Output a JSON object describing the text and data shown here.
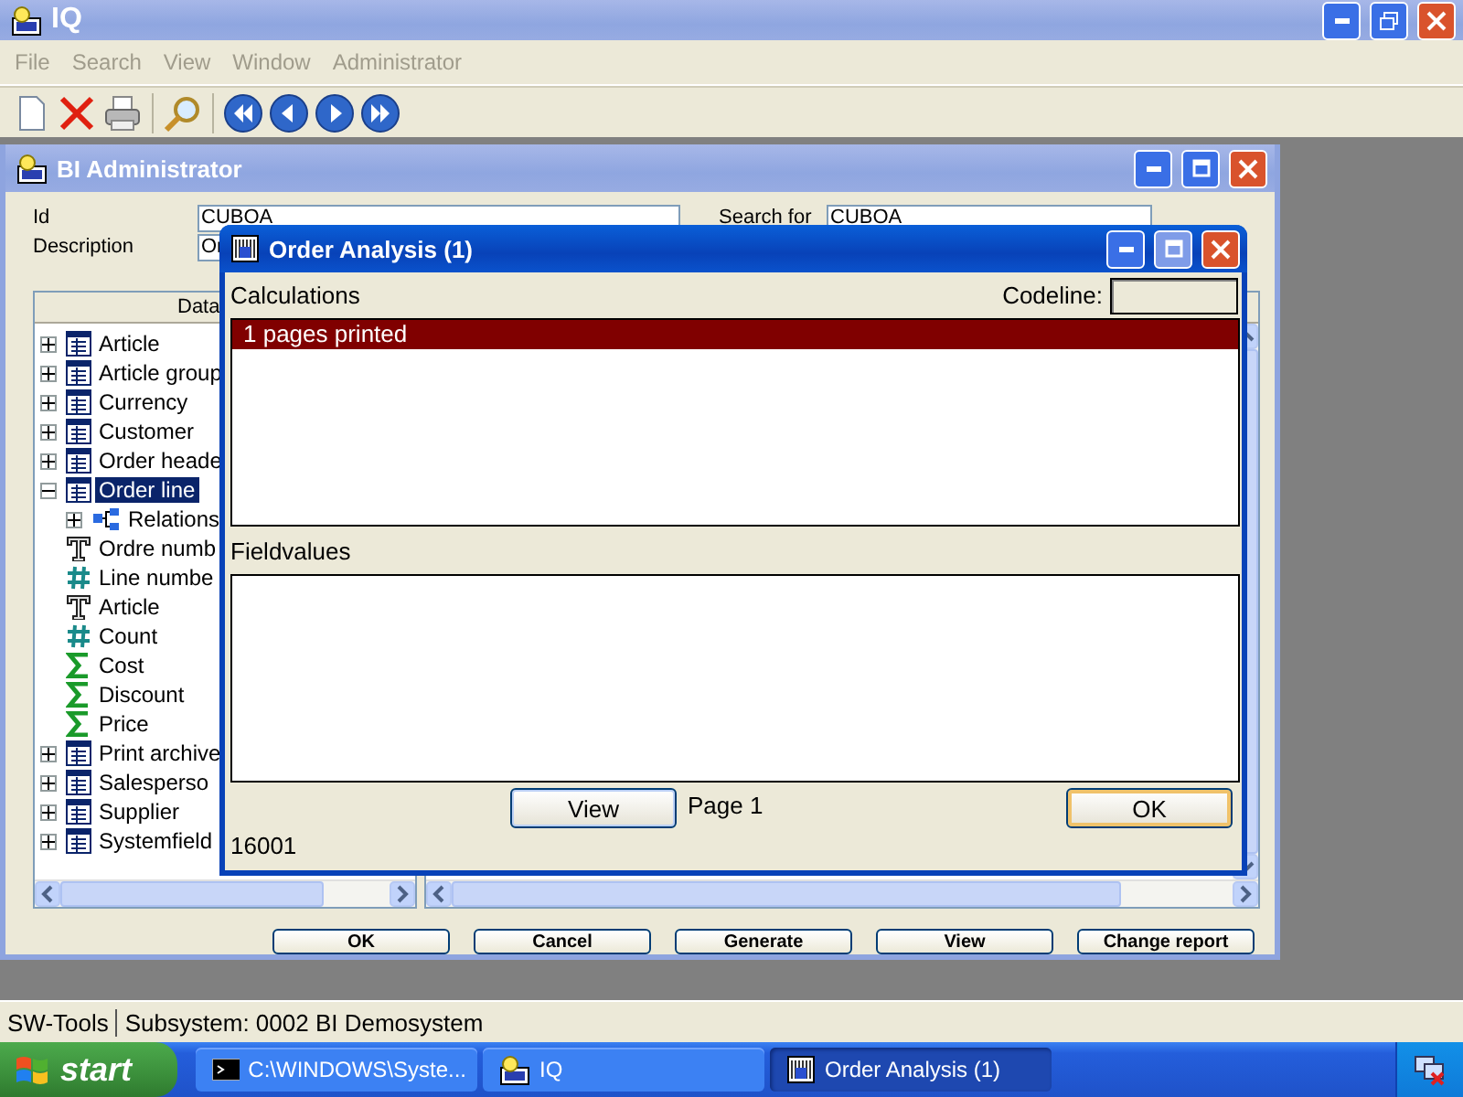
{
  "app_window": {
    "title": "IQ",
    "menu": [
      "File",
      "Search",
      "View",
      "Window",
      "Administrator"
    ]
  },
  "admin_window": {
    "title": "BI Administrator",
    "fields": [
      {
        "label": "Id",
        "value": "CUBOA"
      },
      {
        "label": "Description",
        "value": "Or"
      }
    ],
    "search": {
      "label": "Search for",
      "value": "CUBOA"
    },
    "tree_header": "Data",
    "tree": [
      {
        "label": "Article",
        "kind": "table",
        "expanded": false,
        "selected": false
      },
      {
        "label": "Article group",
        "kind": "table",
        "expanded": false,
        "selected": false
      },
      {
        "label": "Currency",
        "kind": "table",
        "expanded": false,
        "selected": false
      },
      {
        "label": "Customer",
        "kind": "table",
        "expanded": false,
        "selected": false
      },
      {
        "label": "Order heade",
        "kind": "table",
        "expanded": false,
        "selected": false
      },
      {
        "label": "Order line",
        "kind": "table",
        "expanded": true,
        "selected": true,
        "children": [
          {
            "label": "Relations",
            "kind": "relation",
            "expanded": false,
            "selected": false
          },
          {
            "label": "Ordre numb",
            "kind": "text",
            "selected": false
          },
          {
            "label": "Line numbe",
            "kind": "number",
            "selected": false
          },
          {
            "label": "Article",
            "kind": "text",
            "selected": false
          },
          {
            "label": "Count",
            "kind": "number",
            "selected": false
          },
          {
            "label": "Cost",
            "kind": "sum",
            "selected": false
          },
          {
            "label": "Discount",
            "kind": "sum",
            "selected": false
          },
          {
            "label": "Price",
            "kind": "sum",
            "selected": false
          }
        ]
      },
      {
        "label": "Print archive",
        "kind": "table",
        "expanded": false,
        "selected": false
      },
      {
        "label": "Salesperso",
        "kind": "table",
        "expanded": false,
        "selected": false
      },
      {
        "label": "Supplier",
        "kind": "table",
        "expanded": false,
        "selected": false
      },
      {
        "label": "Systemfield",
        "kind": "table",
        "expanded": false,
        "selected": false
      }
    ],
    "buttons": [
      "OK",
      "Cancel",
      "Generate",
      "View",
      "Change report"
    ]
  },
  "dialog": {
    "title": "Order Analysis (1)",
    "calculations_label": "Calculations",
    "codeline_label": "Codeline:",
    "calculations": [
      {
        "text": "1 pages printed",
        "selected": true
      }
    ],
    "fieldvalues_label": "Fieldvalues",
    "view_button": "View",
    "page": "Page 1",
    "ok_button": "OK",
    "status": "16001"
  },
  "status_bar": [
    "SW-Tools",
    "Subsystem: 0002 BI Demosystem"
  ],
  "taskbar": {
    "start": "start",
    "tasks": [
      {
        "label": "C:\\WINDOWS\\Syste...",
        "kind": "console",
        "selected": false
      },
      {
        "label": "IQ",
        "kind": "app",
        "selected": false
      },
      {
        "label": "Order Analysis (1)",
        "kind": "report",
        "selected": true
      }
    ]
  }
}
